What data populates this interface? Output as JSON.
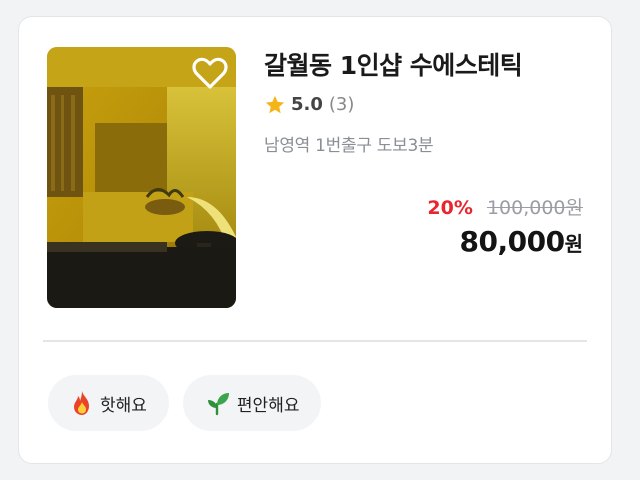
{
  "listing": {
    "title": "갈월동 1인샵 수에스테틱",
    "rating": "5.0",
    "review_count": "(3)",
    "location": "남영역 1번출구 도보3분",
    "discount_rate": "20%",
    "original_price": "100,000원",
    "final_price": "80,000",
    "final_unit": "원",
    "favorite_icon": "heart-outline-icon",
    "rating_icon": "star-icon"
  },
  "tags": [
    {
      "label": "핫해요",
      "icon": "fire-icon"
    },
    {
      "label": "편안해요",
      "icon": "sprout-icon"
    }
  ],
  "colors": {
    "discount": "#e8262f",
    "star": "#f5b418",
    "muted_text": "#8a8f96",
    "tag_background": "#f3f4f6"
  }
}
